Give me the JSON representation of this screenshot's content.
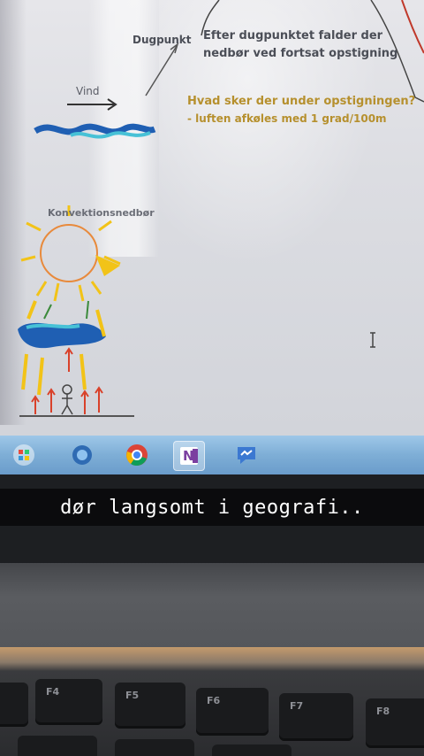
{
  "screen": {
    "labels": {
      "dugpunkt": "Dugpunkt",
      "efter_line1": "Efter dugpunktet falder der",
      "efter_line2": "nedbør ved fortsat opstigning",
      "vind": "Vind",
      "question": "Hvad sker der under opstigningen?",
      "answer": "- luften afkøles med 1 grad/100m",
      "konvektion": "Konvektionsnedbør"
    },
    "taskbar_apps": [
      "windows-start-icon",
      "media-icon",
      "chrome-icon",
      "onenote-icon",
      "messenger-icon"
    ],
    "onenote_letter": "N"
  },
  "caption": "dør langsomt i geografi..",
  "keyboard": {
    "keys": [
      "F4",
      "F5",
      "F6",
      "F7",
      "F8"
    ]
  },
  "colors": {
    "taskbar": "#7eaed6",
    "caption_bg": "#000000",
    "gold_text": "#b6902e",
    "sun": "#f2c318",
    "cloud": "#1f5fb3",
    "arrow": "#d9412a"
  }
}
